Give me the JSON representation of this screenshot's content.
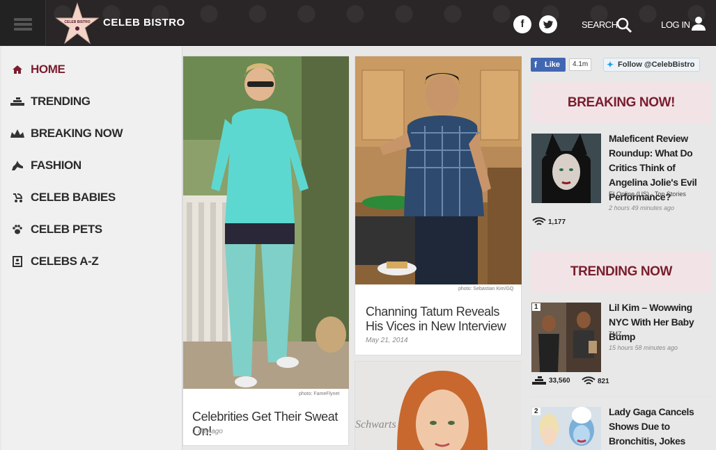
{
  "header": {
    "site_name": "CELEB BISTRO",
    "logo_star_text": "CELEB BISTRO",
    "search_label": "SEARCH",
    "login_label": "LOG IN",
    "social": {
      "facebook": "f",
      "twitter": "t"
    }
  },
  "sidemenu": {
    "items": [
      {
        "label": "HOME",
        "icon": "home-icon"
      },
      {
        "label": "TRENDING",
        "icon": "trending-icon"
      },
      {
        "label": "BREAKING NOW",
        "icon": "crown-icon"
      },
      {
        "label": "FASHION",
        "icon": "high-heel-icon"
      },
      {
        "label": "CELEB BABIES",
        "icon": "stroller-icon"
      },
      {
        "label": "CELEB PETS",
        "icon": "paw-icon"
      },
      {
        "label": "CELEBS A-Z",
        "icon": "directory-icon"
      }
    ]
  },
  "cards": [
    {
      "title": "Celebrities Get Their Sweat On!",
      "date": "1 day ago",
      "credit": "photo: FameFlynet"
    },
    {
      "title": "Channing Tatum Reveals His Vices in New Interview",
      "date": "May 21, 2014",
      "credit": "photo: Sebastian Kim/GQ"
    }
  ],
  "right": {
    "fb_like": "Like",
    "fb_count": "4.1m",
    "twitter_follow": "Follow @CelebBistro",
    "breaking_head": "BREAKING NOW!",
    "trending_head": "TRENDING NOW",
    "breaking_items": [
      {
        "title": "Maleficent Review Roundup: What Do Critics Think of Angelina Jolie's Evil Performance?",
        "source": "E! Online (US) - Top Stories",
        "time": "2 hours 49 minutes ago",
        "buzz": "1,177"
      }
    ],
    "trending_items": [
      {
        "rank": "1",
        "title": "Lil Kim – Wowwing NYC With Her Baby Bump",
        "source": "TMZ",
        "time": "15 hours 58 minutes ago",
        "views": "33,560",
        "buzz": "821"
      },
      {
        "rank": "2",
        "title": "Lady Gaga Cancels Shows Due to Bronchitis, Jokes Ursula"
      }
    ]
  },
  "colors": {
    "accent": "#7a1d2e",
    "header_bg": "#2a2527",
    "menu_bg": "#f0f0f0"
  }
}
